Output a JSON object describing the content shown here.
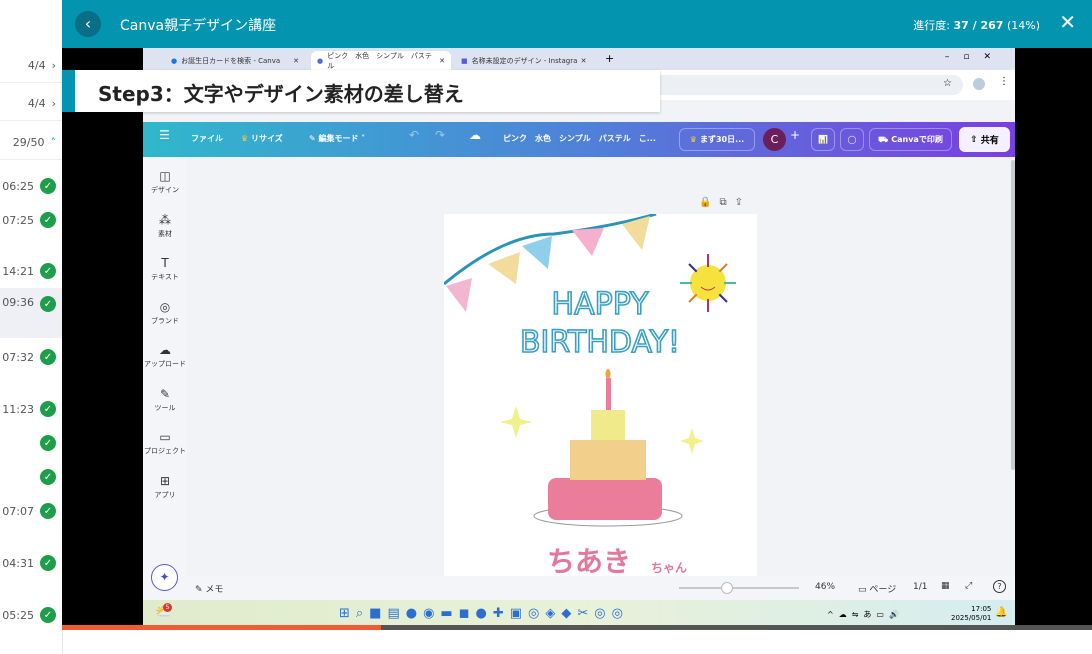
{
  "header": {
    "title": "Canva親子デザイン講座",
    "progress_label": "進行度:",
    "progress_value": "37 / 267",
    "progress_pct": "(14%)",
    "progress_fraction": 0.14
  },
  "sidebar": {
    "sections": [
      {
        "count": "4/4"
      },
      {
        "count": "4/4"
      },
      {
        "count": "29/50"
      }
    ],
    "lessons": [
      {
        "time": "06:25",
        "done": true
      },
      {
        "time": "07:25",
        "done": true
      },
      {
        "time": "14:21",
        "done": true
      },
      {
        "time": "09:36",
        "done": true,
        "active": true
      },
      {
        "time": "07:32",
        "done": true
      },
      {
        "time": "11:23",
        "done": true
      },
      {
        "time": "",
        "done": true
      },
      {
        "time": "",
        "done": true
      },
      {
        "time": "07:07",
        "done": true
      },
      {
        "time": "04:31",
        "done": true
      },
      {
        "time": "05:25",
        "done": true
      }
    ]
  },
  "overlay": {
    "step_title": "Step3：文字やデザイン素材の差し替え"
  },
  "browser": {
    "tabs": [
      "お誕生日カードを検索 - Canva",
      "ピンク　水色　シンプル　パステル",
      "名称未設定のデザイン - Instagram"
    ]
  },
  "canva": {
    "menu": "ファイル",
    "resize": "リサイズ",
    "edit_mode": "編集モード",
    "design_title": "ピンク　水色　シンプル　パステル　こ...",
    "trial": "まず30日...",
    "avatar": "C",
    "print": "Canvaで印刷",
    "share": "共有",
    "left_panel": [
      "デザイン",
      "素材",
      "テキスト",
      "ブランド",
      "アップロード",
      "ツール",
      "プロジェクト",
      "アプリ"
    ],
    "card": {
      "line1": "HAPPY",
      "line2": "BIRTHDAY!",
      "name": "ちあき",
      "suffix": "ちゃん"
    },
    "notes": "メモ",
    "zoom": "46%",
    "zoom_fraction": 0.4,
    "pages_label": "ページ",
    "pages": "1/1"
  },
  "taskbar": {
    "time": "17:05",
    "date": "2025/05/01",
    "ime": "あ",
    "badge": "5"
  },
  "video_progress": 0.31,
  "colors": {
    "header": "#0394b0",
    "progress": "#f05a35",
    "check": "#1e9e4a"
  }
}
